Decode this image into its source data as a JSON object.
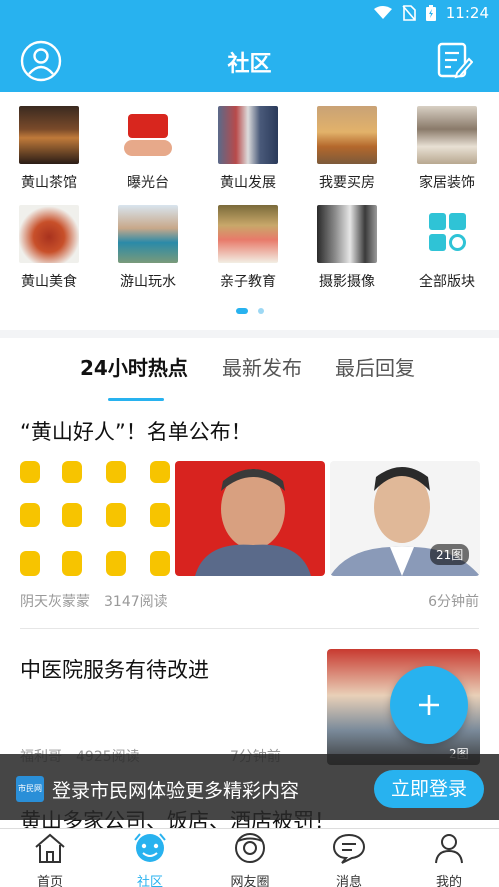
{
  "status_bar": {
    "time": "11:24"
  },
  "header": {
    "title": "社区",
    "avatar_icon": "user-circle-icon",
    "compose_icon": "compose-icon"
  },
  "boards": [
    {
      "label": "黄山茶馆",
      "icon": "teahouse-photo"
    },
    {
      "label": "曝光台",
      "icon": "exposure-photo"
    },
    {
      "label": "黄山发展",
      "icon": "development-photo"
    },
    {
      "label": "我要买房",
      "icon": "house-photo"
    },
    {
      "label": "家居装饰",
      "icon": "decoration-photo"
    },
    {
      "label": "黄山美食",
      "icon": "food-photo"
    },
    {
      "label": "游山玩水",
      "icon": "travel-photo"
    },
    {
      "label": "亲子教育",
      "icon": "education-photo"
    },
    {
      "label": "摄影摄像",
      "icon": "photography-photo"
    },
    {
      "label": "全部版块",
      "icon": "all-boards-icon"
    }
  ],
  "tabs": [
    {
      "label": "24小时热点",
      "active": true
    },
    {
      "label": "最新发布",
      "active": false
    },
    {
      "label": "最后回复",
      "active": false
    }
  ],
  "posts": [
    {
      "title": "“黄山好人”！名单公布！",
      "author": "阴天灰蒙蒙",
      "reads": "3147阅读",
      "time": "6分钟前",
      "image_count": "21图"
    },
    {
      "title": "中医院服务有待改进",
      "author": "福利哥",
      "reads": "4925阅读",
      "time": "7分钟前",
      "image_count": "2图"
    },
    {
      "title": "黄山多家公司、饭店、酒店被罚！"
    }
  ],
  "login_banner": {
    "logo_text": "市民网",
    "text": "登录市民网体验更多精彩内容",
    "button": "立即登录"
  },
  "bottom_nav": [
    {
      "label": "首页",
      "icon": "home-icon"
    },
    {
      "label": "社区",
      "icon": "community-icon",
      "active": true
    },
    {
      "label": "网友圈",
      "icon": "friends-circle-icon"
    },
    {
      "label": "消息",
      "icon": "message-icon"
    },
    {
      "label": "我的",
      "icon": "profile-icon"
    }
  ],
  "colors": {
    "brand": "#28b2ef",
    "fab": "#28b2ef"
  }
}
